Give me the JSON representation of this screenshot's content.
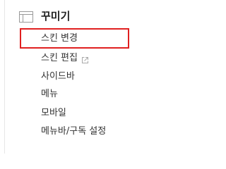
{
  "sidebar": {
    "section_title": "꾸미기",
    "section_icon": "layout-icon",
    "items": [
      {
        "label": "스킨 변경",
        "highlighted": true
      },
      {
        "label": "스킨 편집",
        "icon": "external-link-icon"
      },
      {
        "label": "사이드바"
      },
      {
        "label": "메뉴"
      },
      {
        "label": "모바일"
      },
      {
        "label": "메뉴바/구독 설정"
      }
    ]
  },
  "colors": {
    "highlight_border": "#e02020",
    "text": "#333333",
    "icon": "#999999"
  }
}
